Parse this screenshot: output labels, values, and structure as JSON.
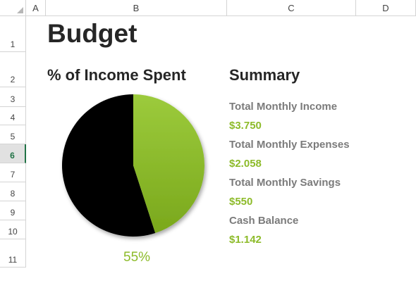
{
  "columns": [
    "A",
    "B",
    "C",
    "D"
  ],
  "rows": [
    "1",
    "2",
    "3",
    "4",
    "5",
    "6",
    "7",
    "8",
    "9",
    "10",
    "11"
  ],
  "active_row": "6",
  "sheet": {
    "title": "Budget",
    "pie_heading": "% of Income Spent",
    "summary_heading": "Summary",
    "items": [
      {
        "label": "Total Monthly Income",
        "value": "$3.750"
      },
      {
        "label": "Total Monthly Expenses",
        "value": "$2.058"
      },
      {
        "label": "Total Monthly Savings",
        "value": "$550"
      },
      {
        "label": "Cash Balance",
        "value": "$1.142"
      }
    ],
    "percent_label": "55%"
  },
  "chart_data": {
    "type": "pie",
    "title": "% of Income Spent",
    "slices": [
      {
        "value": 55,
        "color": "#000000"
      },
      {
        "value": 45,
        "color": "#8dbb2a"
      }
    ]
  },
  "colors": {
    "accent_green": "#8dbb2a",
    "label_gray": "#7b7b7b",
    "heading_dark": "#262626",
    "active_row_green": "#217346"
  }
}
